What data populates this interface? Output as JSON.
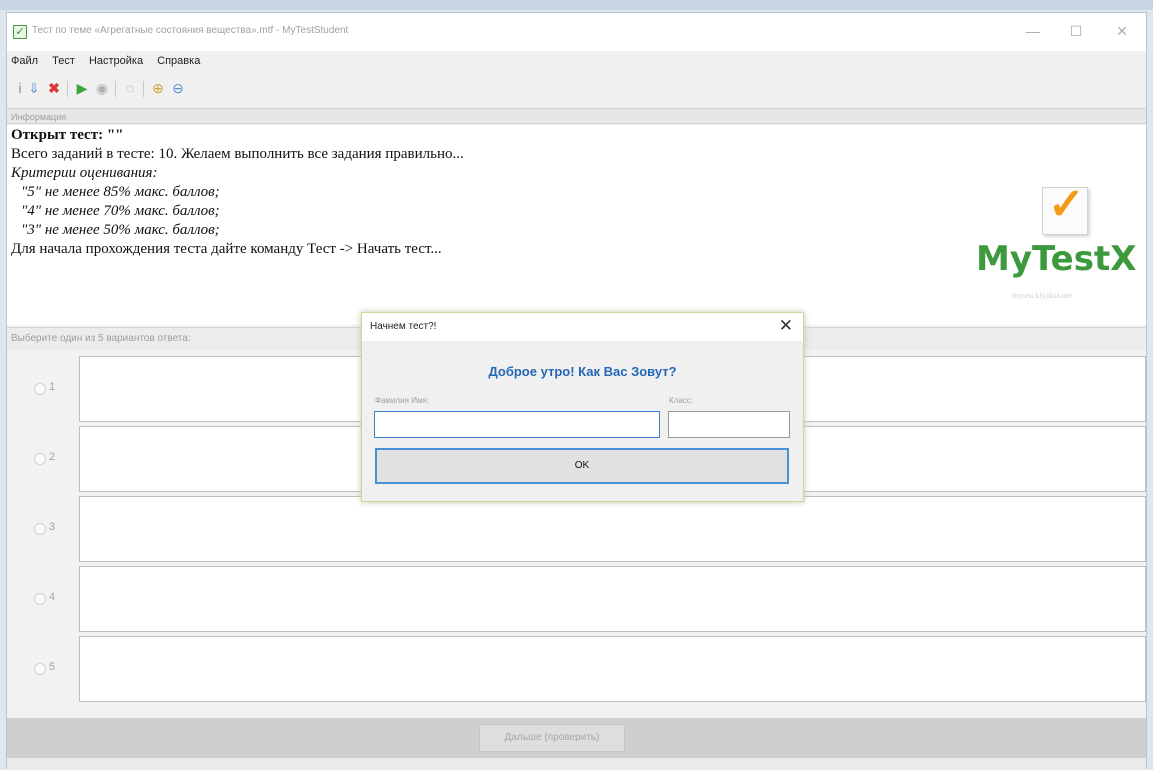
{
  "window": {
    "title": "Тест по теме «Агрегатные состояния вещества».mtf - MyTestStudent",
    "minimize": "—",
    "maximize": "☐",
    "close": "✕"
  },
  "menu": [
    "Файл",
    "Тест",
    "Настройка",
    "Справка"
  ],
  "info": {
    "header": "Информация",
    "opened_label": "Открыт тест:",
    "opened_value": "\"\"",
    "total": "Всего заданий в тесте: 10. Желаем выполнить все задания правильно...",
    "criteria": "Критерии оценивания:",
    "grade5": "\"5\" не менее 85% макс. баллов;",
    "grade4": "\"4\" не менее 70% макс. баллов;",
    "grade3": "\"3\" не менее 50% макс. баллов;",
    "start_hint": "Для начала прохождения теста дайте команду Тест -> Начать тест..."
  },
  "logo": {
    "word": "MyTestX",
    "sub": "mytest.klyaksa.net",
    "color": "#3c9a3d",
    "check_color": "#f39b12"
  },
  "answers": {
    "header": "Выберите один из 5 вариантов ответа:",
    "options": [
      "1",
      "2",
      "3",
      "4",
      "5"
    ]
  },
  "footer": {
    "next_label": "Дальше (проверить)"
  },
  "dialog": {
    "title": "Начнем тест?!",
    "close": "✕",
    "greeting": "Доброе утро! Как Вас Зовут?",
    "name_label": "Фамилия Имя:",
    "class_label": "Класс:",
    "name_value": "",
    "class_value": "",
    "ok_label": "OK",
    "accent": "#2467b5"
  }
}
